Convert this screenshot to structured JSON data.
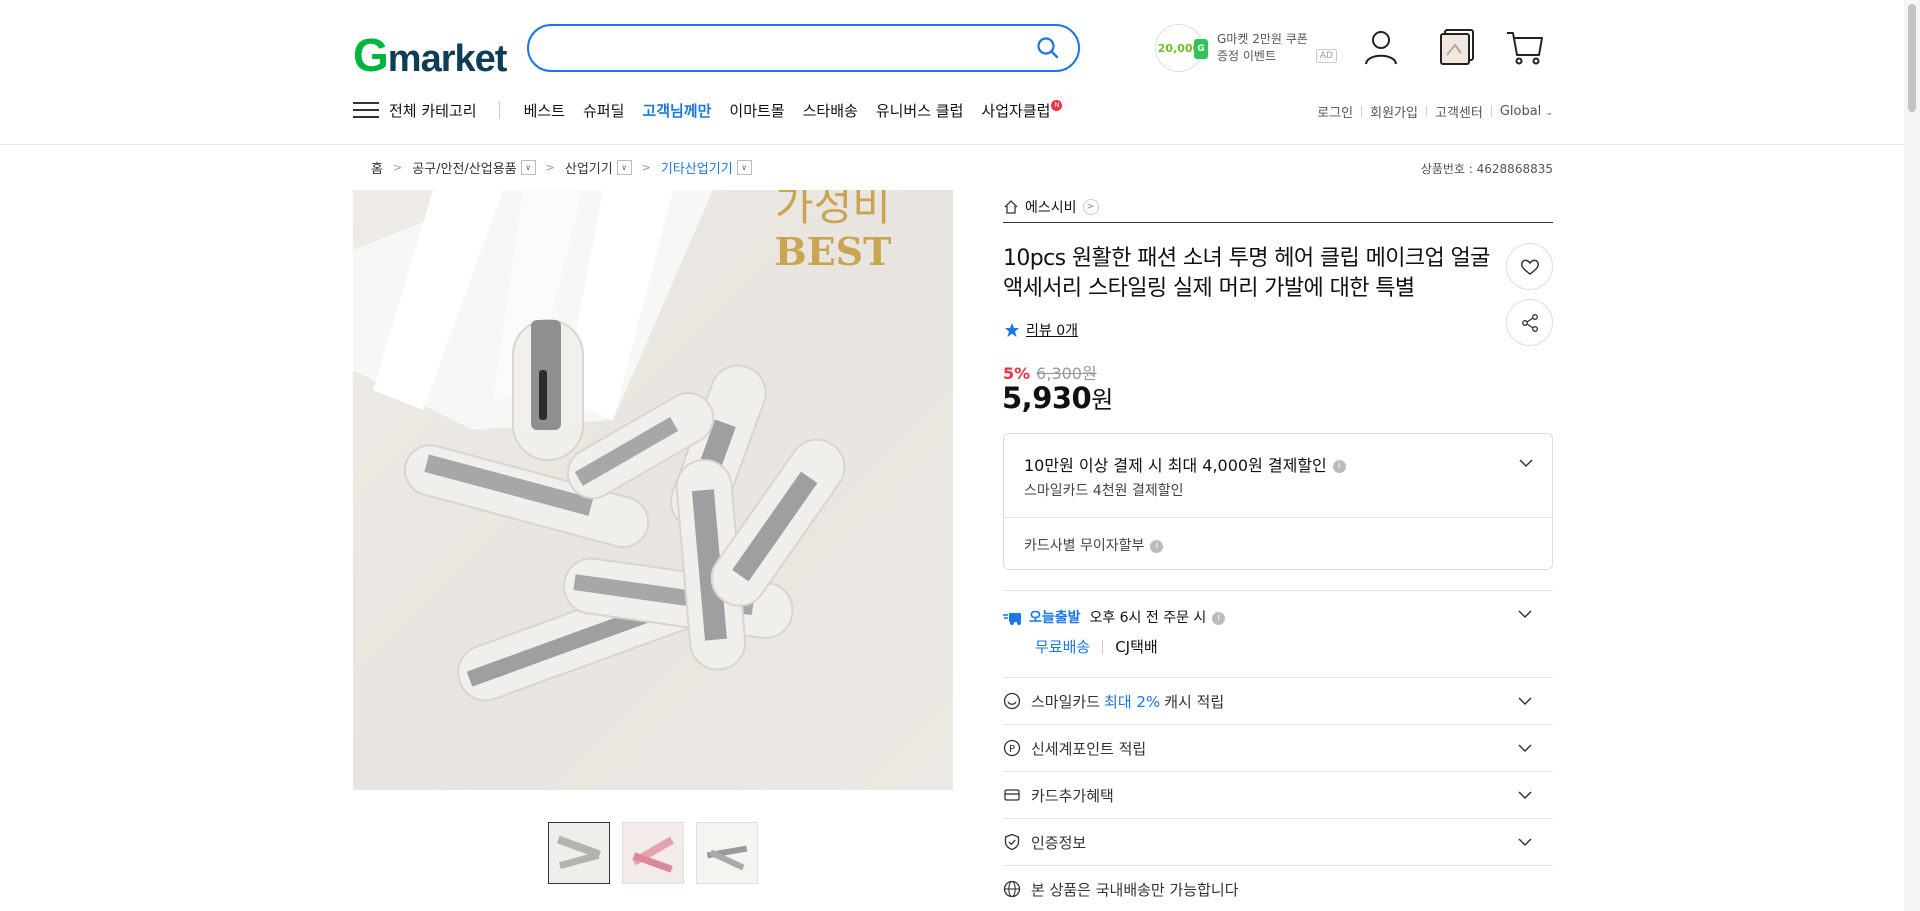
{
  "header": {
    "logo_g": "G",
    "logo_rest": "market",
    "search_placeholder": "",
    "coupon_amount": "20,000",
    "coupon_g": "G",
    "coupon_line1": "G마켓 2만원 쿠폰",
    "coupon_line2": "증정 이벤트",
    "ad": "AD"
  },
  "nav": {
    "all_categories": "전체 카테고리",
    "items": [
      "베스트",
      "슈퍼딜",
      "고객님께만",
      "이마트몰",
      "스타배송",
      "유니버스 클럽",
      "사업자클럽"
    ],
    "new_badge": "N",
    "util": [
      "로그인",
      "회원가입",
      "고객센터",
      "Global"
    ]
  },
  "breadcrumb": {
    "home": "홈",
    "c1": "공구/안전/산업용품",
    "c2": "산업기기",
    "c3": "기타산업기기"
  },
  "product_no": "상품번호 : 4628868835",
  "image_overlay": {
    "line1": "가성비",
    "line2": "BEST"
  },
  "store": "에스시비",
  "title": "10pcs 원활한 패션 소녀 투명 헤어 클립 메이크업 얼굴 액세서리 스타일링 실제 머리 가발에 대한 특별",
  "review": "리뷰 0개",
  "discount": {
    "percent": "5%",
    "original": "6,300원"
  },
  "price": {
    "amount": "5,930",
    "unit": "원"
  },
  "benefit": {
    "line1": "10만원 이상 결제 시 최대 4,000원 결제할인",
    "line2": "스마일카드 4천원 결제할인",
    "line3": "카드사별 무이자할부",
    "info": "i"
  },
  "shipping": {
    "today": "오늘출발",
    "cutoff": "오후 6시 전 주문 시",
    "free": "무료배송",
    "courier": "CJ택배"
  },
  "rows": {
    "smile_pre": "스마일카드",
    "smile_hl": "최대 2%",
    "smile_post": "캐시 적립",
    "shinsegae": "신세계포인트 적립",
    "card": "카드추가혜택",
    "cert": "인증정보",
    "domestic": "본 상품은 국내배송만 가능합니다"
  }
}
